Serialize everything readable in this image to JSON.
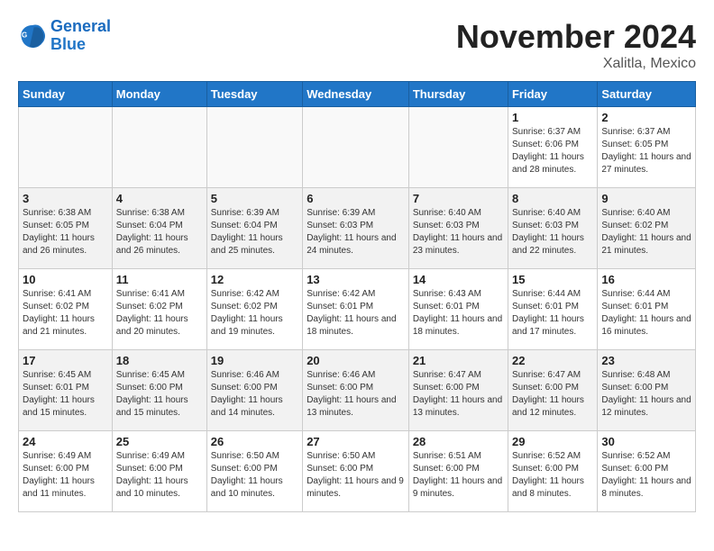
{
  "logo": {
    "line1": "General",
    "line2": "Blue"
  },
  "title": "November 2024",
  "location": "Xalitla, Mexico",
  "days_of_week": [
    "Sunday",
    "Monday",
    "Tuesday",
    "Wednesday",
    "Thursday",
    "Friday",
    "Saturday"
  ],
  "weeks": [
    [
      {
        "day": "",
        "info": ""
      },
      {
        "day": "",
        "info": ""
      },
      {
        "day": "",
        "info": ""
      },
      {
        "day": "",
        "info": ""
      },
      {
        "day": "",
        "info": ""
      },
      {
        "day": "1",
        "info": "Sunrise: 6:37 AM\nSunset: 6:06 PM\nDaylight: 11 hours and 28 minutes."
      },
      {
        "day": "2",
        "info": "Sunrise: 6:37 AM\nSunset: 6:05 PM\nDaylight: 11 hours and 27 minutes."
      }
    ],
    [
      {
        "day": "3",
        "info": "Sunrise: 6:38 AM\nSunset: 6:05 PM\nDaylight: 11 hours and 26 minutes."
      },
      {
        "day": "4",
        "info": "Sunrise: 6:38 AM\nSunset: 6:04 PM\nDaylight: 11 hours and 26 minutes."
      },
      {
        "day": "5",
        "info": "Sunrise: 6:39 AM\nSunset: 6:04 PM\nDaylight: 11 hours and 25 minutes."
      },
      {
        "day": "6",
        "info": "Sunrise: 6:39 AM\nSunset: 6:03 PM\nDaylight: 11 hours and 24 minutes."
      },
      {
        "day": "7",
        "info": "Sunrise: 6:40 AM\nSunset: 6:03 PM\nDaylight: 11 hours and 23 minutes."
      },
      {
        "day": "8",
        "info": "Sunrise: 6:40 AM\nSunset: 6:03 PM\nDaylight: 11 hours and 22 minutes."
      },
      {
        "day": "9",
        "info": "Sunrise: 6:40 AM\nSunset: 6:02 PM\nDaylight: 11 hours and 21 minutes."
      }
    ],
    [
      {
        "day": "10",
        "info": "Sunrise: 6:41 AM\nSunset: 6:02 PM\nDaylight: 11 hours and 21 minutes."
      },
      {
        "day": "11",
        "info": "Sunrise: 6:41 AM\nSunset: 6:02 PM\nDaylight: 11 hours and 20 minutes."
      },
      {
        "day": "12",
        "info": "Sunrise: 6:42 AM\nSunset: 6:02 PM\nDaylight: 11 hours and 19 minutes."
      },
      {
        "day": "13",
        "info": "Sunrise: 6:42 AM\nSunset: 6:01 PM\nDaylight: 11 hours and 18 minutes."
      },
      {
        "day": "14",
        "info": "Sunrise: 6:43 AM\nSunset: 6:01 PM\nDaylight: 11 hours and 18 minutes."
      },
      {
        "day": "15",
        "info": "Sunrise: 6:44 AM\nSunset: 6:01 PM\nDaylight: 11 hours and 17 minutes."
      },
      {
        "day": "16",
        "info": "Sunrise: 6:44 AM\nSunset: 6:01 PM\nDaylight: 11 hours and 16 minutes."
      }
    ],
    [
      {
        "day": "17",
        "info": "Sunrise: 6:45 AM\nSunset: 6:01 PM\nDaylight: 11 hours and 15 minutes."
      },
      {
        "day": "18",
        "info": "Sunrise: 6:45 AM\nSunset: 6:00 PM\nDaylight: 11 hours and 15 minutes."
      },
      {
        "day": "19",
        "info": "Sunrise: 6:46 AM\nSunset: 6:00 PM\nDaylight: 11 hours and 14 minutes."
      },
      {
        "day": "20",
        "info": "Sunrise: 6:46 AM\nSunset: 6:00 PM\nDaylight: 11 hours and 13 minutes."
      },
      {
        "day": "21",
        "info": "Sunrise: 6:47 AM\nSunset: 6:00 PM\nDaylight: 11 hours and 13 minutes."
      },
      {
        "day": "22",
        "info": "Sunrise: 6:47 AM\nSunset: 6:00 PM\nDaylight: 11 hours and 12 minutes."
      },
      {
        "day": "23",
        "info": "Sunrise: 6:48 AM\nSunset: 6:00 PM\nDaylight: 11 hours and 12 minutes."
      }
    ],
    [
      {
        "day": "24",
        "info": "Sunrise: 6:49 AM\nSunset: 6:00 PM\nDaylight: 11 hours and 11 minutes."
      },
      {
        "day": "25",
        "info": "Sunrise: 6:49 AM\nSunset: 6:00 PM\nDaylight: 11 hours and 10 minutes."
      },
      {
        "day": "26",
        "info": "Sunrise: 6:50 AM\nSunset: 6:00 PM\nDaylight: 11 hours and 10 minutes."
      },
      {
        "day": "27",
        "info": "Sunrise: 6:50 AM\nSunset: 6:00 PM\nDaylight: 11 hours and 9 minutes."
      },
      {
        "day": "28",
        "info": "Sunrise: 6:51 AM\nSunset: 6:00 PM\nDaylight: 11 hours and 9 minutes."
      },
      {
        "day": "29",
        "info": "Sunrise: 6:52 AM\nSunset: 6:00 PM\nDaylight: 11 hours and 8 minutes."
      },
      {
        "day": "30",
        "info": "Sunrise: 6:52 AM\nSunset: 6:00 PM\nDaylight: 11 hours and 8 minutes."
      }
    ]
  ]
}
